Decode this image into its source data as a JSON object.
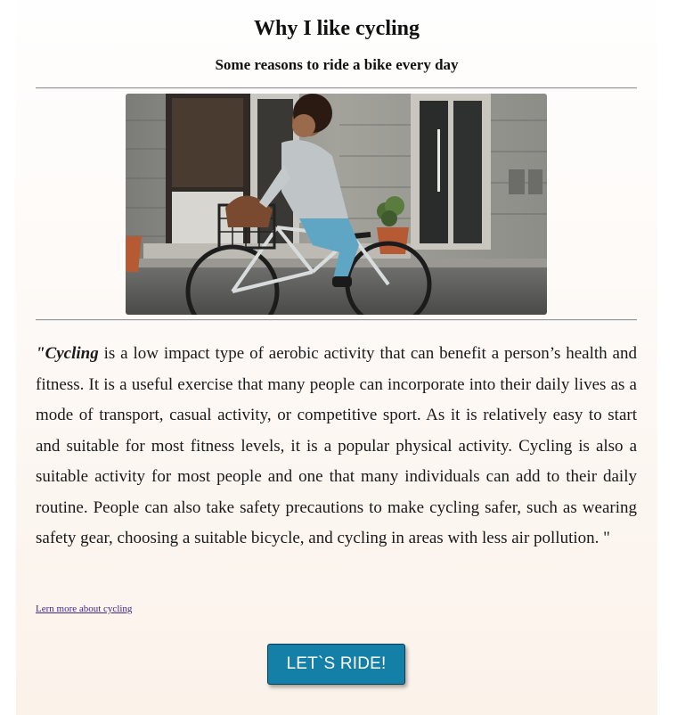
{
  "page": {
    "title": "Why I like cycling",
    "subtitle": "Some reasons to ride a bike every day"
  },
  "image": {
    "alt": "Woman riding a bicycle on a city street"
  },
  "article": {
    "quote_open": "\"",
    "lead_word": "Cycling",
    "body": " is a low impact type of aerobic activity that can benefit a person’s health and fitness. It is a useful exercise that many people can incorporate into their daily lives as a mode of transport, casual activity, or competitive sport. As it is relatively easy to start and suitable for most fitness levels, it is a popular physical activity. Cycling is also a suitable activity for most people and one that many individuals can add to their daily routine. People can also take safety precautions to make cycling safer, such as wearing safety gear, choosing a suitable bicycle, and cycling in areas with less air pollution. \""
  },
  "link": {
    "label": "Lern more about cycling"
  },
  "cta": {
    "label": "LET`S RIDE!"
  },
  "colors": {
    "button": "#1480a7",
    "link": "#3d2a8a",
    "rule": "#9a9a9a"
  }
}
